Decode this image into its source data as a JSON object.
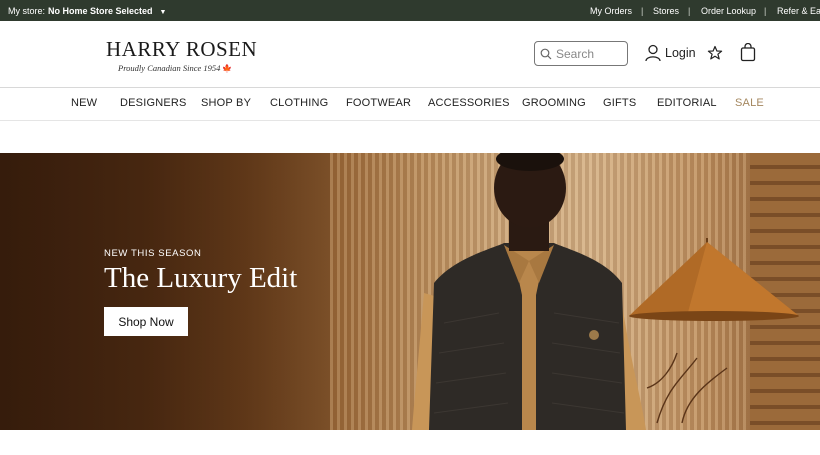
{
  "topbar": {
    "store_label": "My store:",
    "store_value": "No Home Store Selected",
    "store_caret": "▼",
    "links": [
      "My Orders",
      "Stores",
      "Order Lookup",
      "Refer & Earn"
    ],
    "separator": "|",
    "bg_color": "#2f3a2e"
  },
  "header": {
    "logo_name": "HARRY ROSEN",
    "logo_tagline": "Proudly Canadian Since 1954",
    "logo_leaf": "🍁",
    "search_placeholder": "Search",
    "login_label": "Login",
    "icons": [
      "search-icon",
      "user-icon",
      "star-icon",
      "shopping-bag-icon"
    ]
  },
  "nav": {
    "items": [
      "NEW",
      "DESIGNERS",
      "SHOP BY",
      "CLOTHING",
      "FOOTWEAR",
      "ACCESSORIES",
      "GROOMING",
      "GIFTS",
      "EDITORIAL",
      "SALE"
    ],
    "sale_color": "#a4875f"
  },
  "hero": {
    "eyebrow": "NEW THIS SEASON",
    "headline": "The Luxury Edit",
    "cta_label": "Shop Now"
  }
}
